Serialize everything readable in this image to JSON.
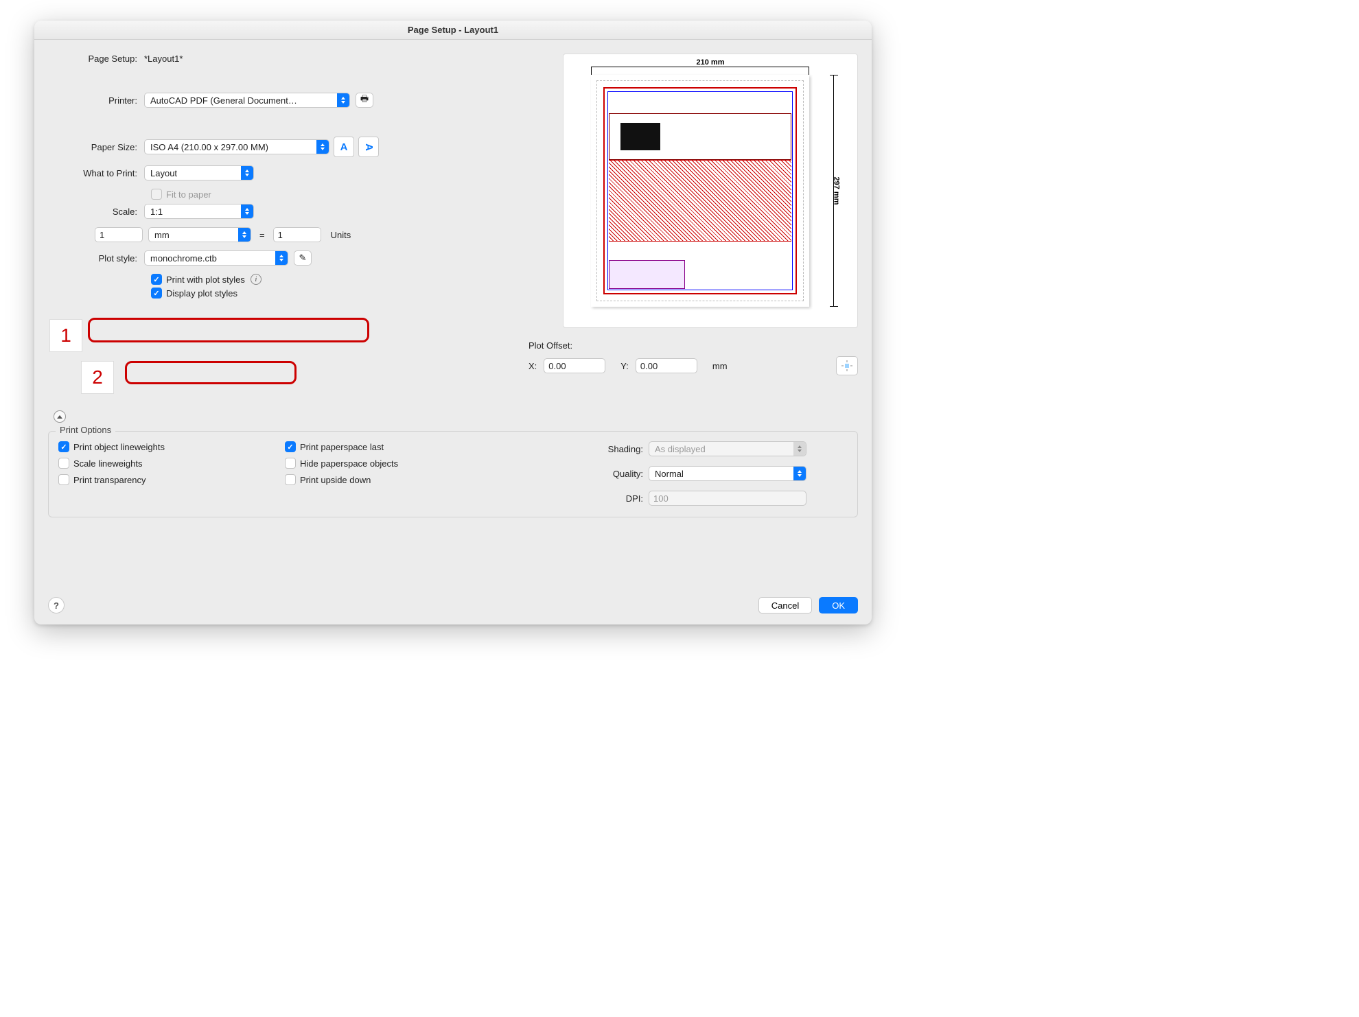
{
  "title": "Page Setup - Layout1",
  "pageSetupLabel": "Page Setup:",
  "pageSetupValue": "*Layout1*",
  "printerLabel": "Printer:",
  "printerValue": "AutoCAD PDF (General Document…",
  "paperSizeLabel": "Paper Size:",
  "paperSizeValue": "ISO A4 (210.00 x 297.00 MM)",
  "whatToPrintLabel": "What to Print:",
  "whatToPrintValue": "Layout",
  "fitToPaper": "Fit to paper",
  "scaleLabel": "Scale:",
  "scaleValue": "1:1",
  "scaleDrawing": "1",
  "scaleUnitsSel": "mm",
  "equals": "=",
  "scalePaper": "1",
  "unitsWord": "Units",
  "plotStyleLabel": "Plot style:",
  "plotStyleValue": "monochrome.ctb",
  "printWithPlotStyles": "Print with plot styles",
  "displayPlotStyles": "Display plot styles",
  "preview": {
    "width": "210 mm",
    "height": "297 mm"
  },
  "plotOffset": {
    "title": "Plot Offset:",
    "xLabel": "X:",
    "x": "0.00",
    "yLabel": "Y:",
    "y": "0.00",
    "unit": "mm"
  },
  "printOptions": {
    "title": "Print Options",
    "objLineweights": "Print object lineweights",
    "scaleLineweights": "Scale lineweights",
    "transparency": "Print transparency",
    "paperspaceLast": "Print paperspace last",
    "hidePaperspace": "Hide paperspace objects",
    "upsideDown": "Print upside down",
    "shadingLabel": "Shading:",
    "shadingValue": "As displayed",
    "qualityLabel": "Quality:",
    "qualityValue": "Normal",
    "dpiLabel": "DPI:",
    "dpiValue": "100"
  },
  "buttons": {
    "cancel": "Cancel",
    "ok": "OK",
    "help": "?"
  },
  "callouts": {
    "one": "1",
    "two": "2"
  },
  "glyphs": {
    "A": "A",
    "Arot": "A",
    "printerIcon": "🖶",
    "editIcon": "✎",
    "info": "i"
  }
}
